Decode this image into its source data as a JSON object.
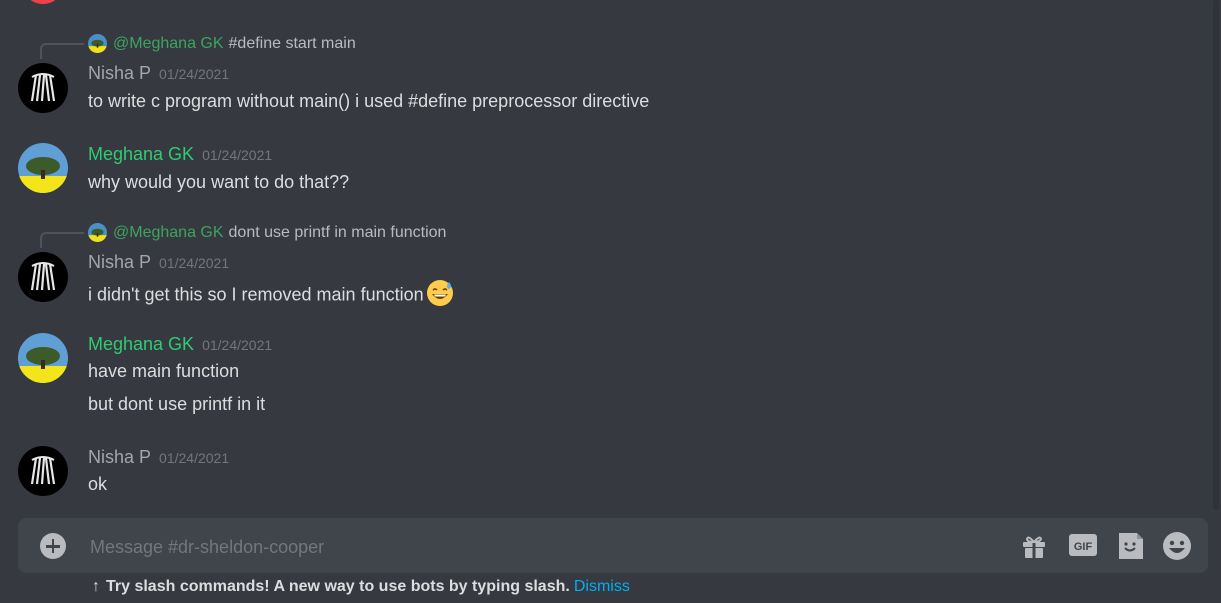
{
  "messages": [
    {
      "reply": {
        "mention": "@Meghana GK",
        "snippet": "#define start main"
      },
      "author": "Nisha P",
      "timestamp": "01/24/2021",
      "lines": [
        "to write c program without main() i used #define preprocessor directive"
      ]
    },
    {
      "author": "Meghana GK",
      "timestamp": "01/24/2021",
      "lines": [
        "why would you want to do that??"
      ]
    },
    {
      "reply": {
        "mention": "@Meghana GK",
        "snippet": "dont use printf in main function"
      },
      "author": "Nisha P",
      "timestamp": "01/24/2021",
      "lines": [
        "i didn't get this so I removed main function"
      ],
      "emoji": "sweat-smile"
    },
    {
      "author": "Meghana GK",
      "timestamp": "01/24/2021",
      "lines": [
        "have main function",
        "but dont use printf in it"
      ]
    },
    {
      "author": "Nisha P",
      "timestamp": "01/24/2021",
      "lines": [
        "ok"
      ]
    }
  ],
  "composer": {
    "placeholder": "Message #dr-sheldon-cooper",
    "gif_label": "GIF"
  },
  "hint": {
    "arrow": "↑",
    "text": "Try slash commands! A new way to use bots by typing slash.",
    "dismiss": "Dismiss"
  },
  "colors": {
    "background": "#36393f",
    "composer": "#40444b",
    "nisha": "#a3a6aa",
    "meghana": "#2ecc71",
    "mention": "#3ba55c",
    "link": "#00aff4"
  }
}
